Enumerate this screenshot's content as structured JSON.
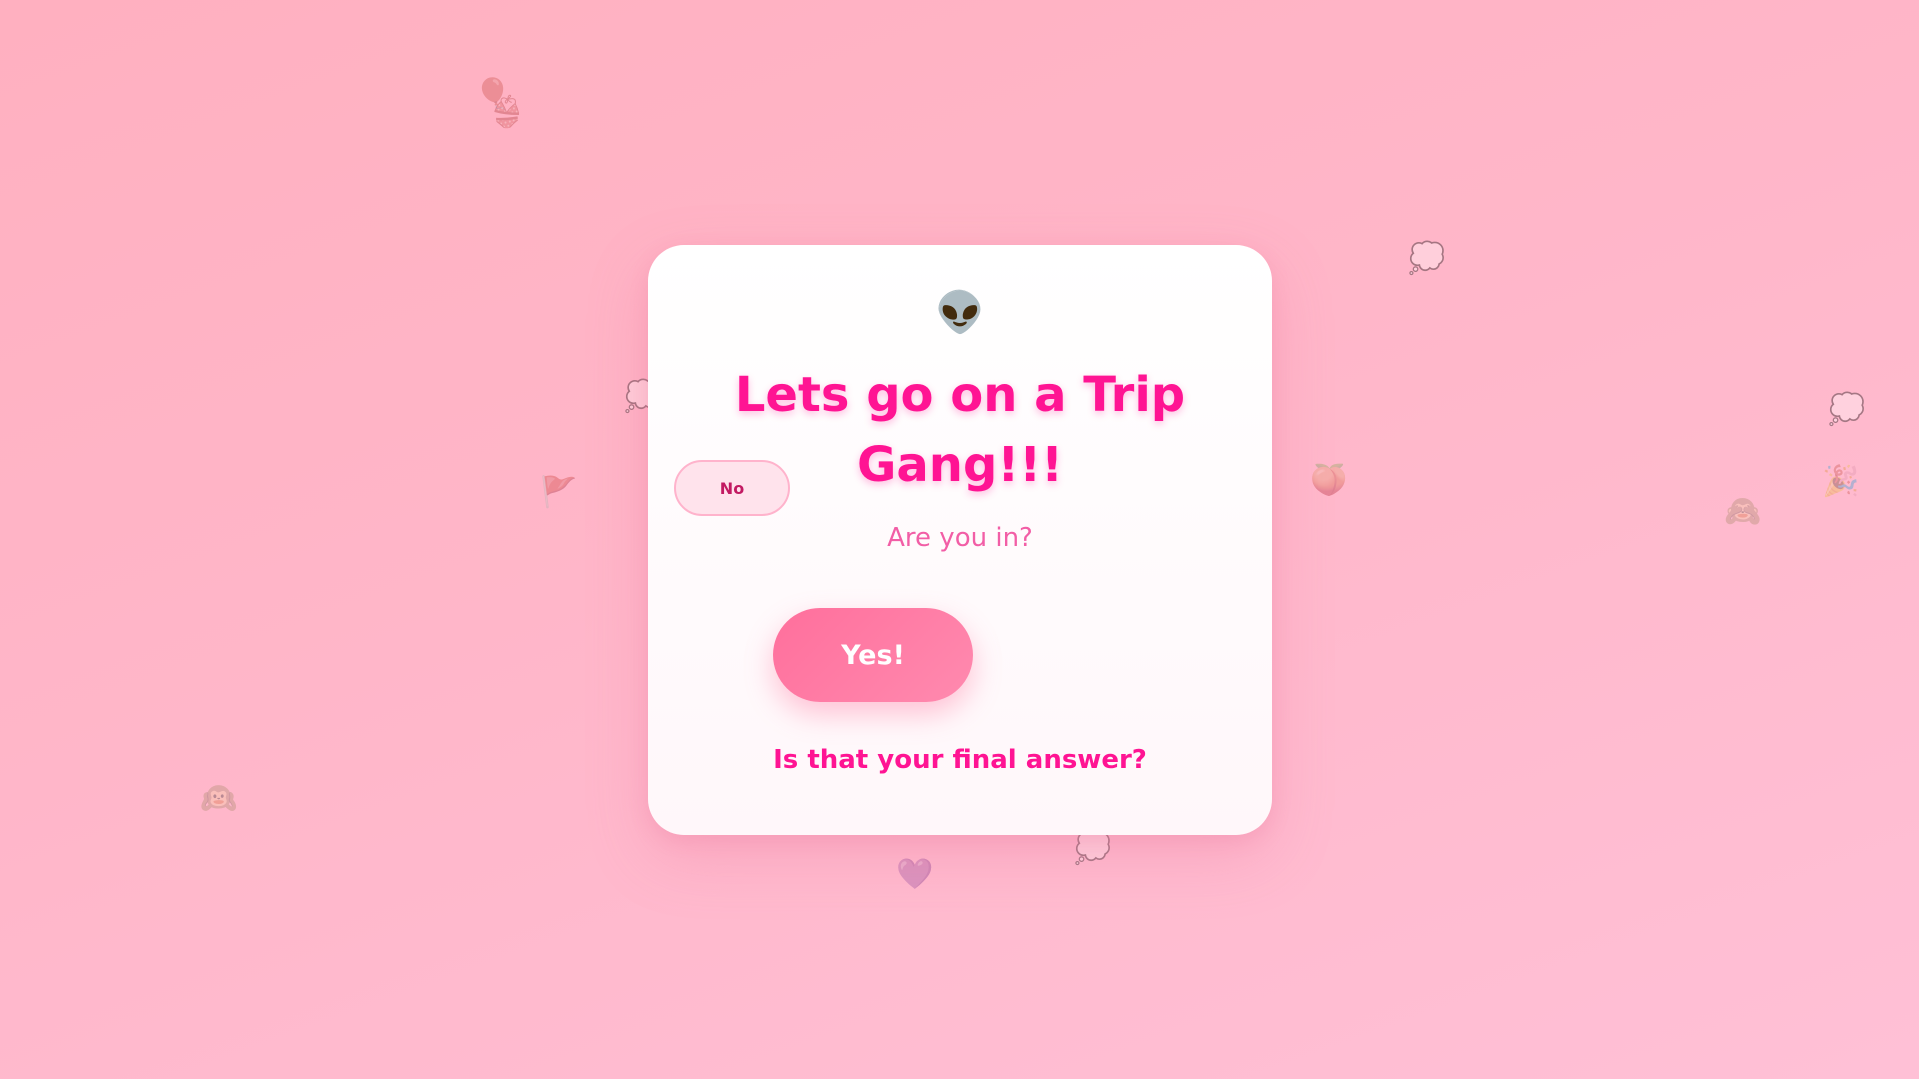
{
  "card": {
    "emoji": "👽",
    "title": "Lets go on a Trip Gang!!!",
    "subtitle": "Are you in?",
    "no_label": "No",
    "yes_label": "Yes!",
    "final_question": "Is that your final answer?"
  },
  "background_emojis": [
    "🎈",
    "👙",
    "💭",
    "💭",
    "🍑",
    "💭",
    "🎉",
    "🙈",
    "🚩",
    "🙉",
    "💭",
    "💜"
  ],
  "colors": {
    "background_start": "#ffb0c0",
    "background_end": "#ffc0d6",
    "title": "#ff1493",
    "subtitle": "#f25ea6",
    "yes_button": "#ff7aa5",
    "no_button": "#ffe3ec",
    "no_button_text": "#c21a62"
  }
}
